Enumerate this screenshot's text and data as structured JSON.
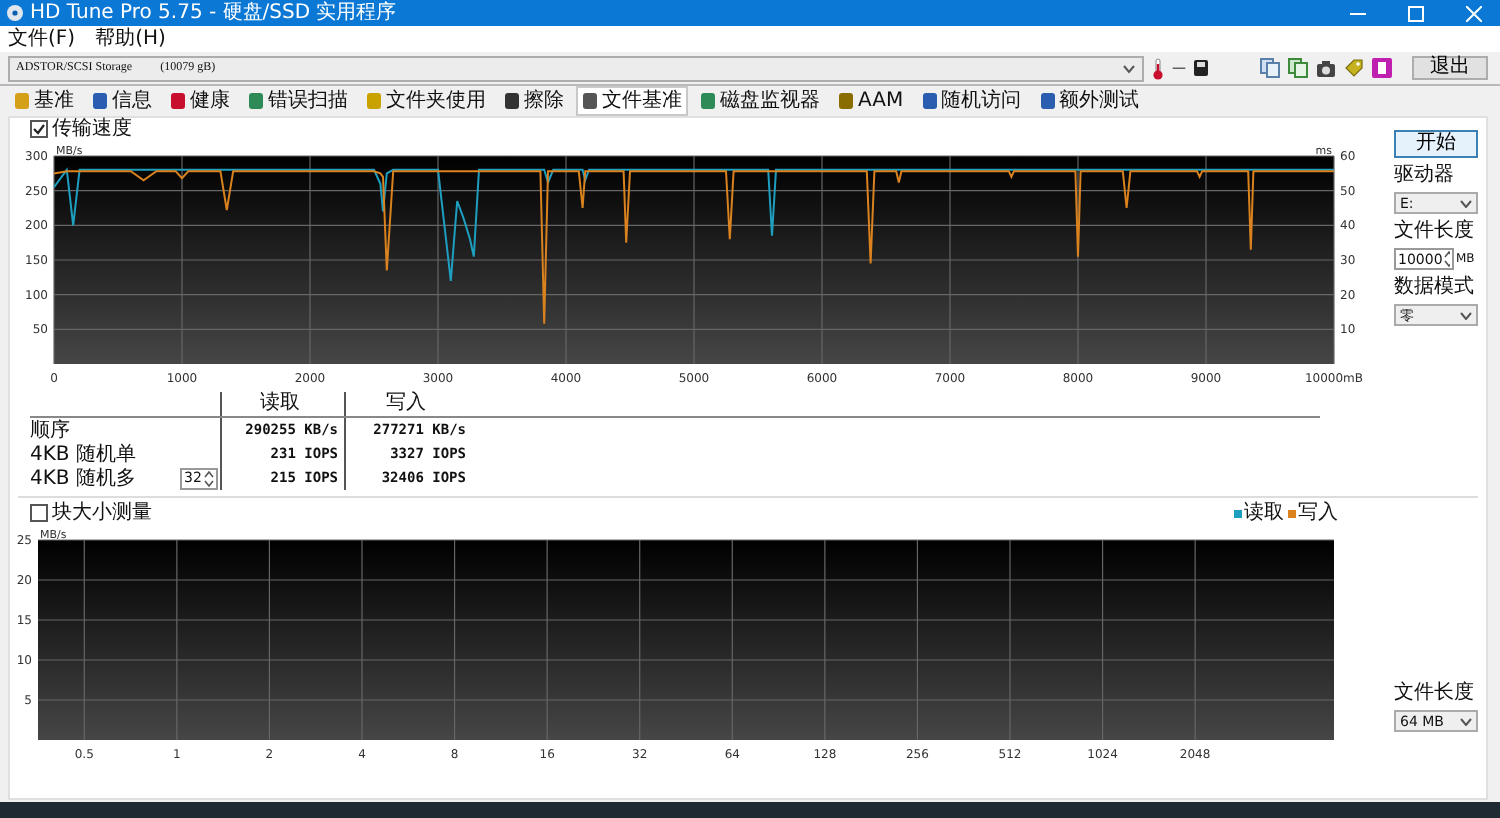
{
  "window": {
    "title": "HD Tune Pro 5.75 - 硬盘/SSD 实用程序"
  },
  "menu": [
    "文件(F)",
    "帮助(H)"
  ],
  "drive_bar": {
    "drive": "ADSTOR/SCSI Storage",
    "capacity": "(10079 gB)",
    "temperature": "—",
    "exit_button": "退出"
  },
  "tabs": [
    {
      "label": "基准",
      "selected": false
    },
    {
      "label": "信息",
      "selected": false
    },
    {
      "label": "健康",
      "selected": false
    },
    {
      "label": "错误扫描",
      "selected": false
    },
    {
      "label": "文件夹使用",
      "selected": false
    },
    {
      "label": "擦除",
      "selected": false
    },
    {
      "label": "文件基准",
      "selected": true
    },
    {
      "label": "磁盘监视器",
      "selected": false
    },
    {
      "label": "AAM",
      "selected": false
    },
    {
      "label": "随机访问",
      "selected": false
    },
    {
      "label": "额外测试",
      "selected": false
    }
  ],
  "transfer": {
    "checkbox": {
      "label": "传输速度",
      "checked": true
    },
    "right_axis": {
      "label": "ms",
      "ticks": [
        "60",
        "50",
        "40",
        "30",
        "20",
        "10"
      ]
    },
    "chart_data": {
      "type": "line",
      "ylabel": "MB/s",
      "xlim": [
        0,
        10000
      ],
      "ylim": [
        0,
        300
      ],
      "grid": true,
      "xticks": [
        0,
        1000,
        2000,
        3000,
        4000,
        5000,
        6000,
        7000,
        8000,
        9000,
        {
          "value": 10000,
          "label": "10000mB"
        }
      ],
      "yticks": [
        50,
        100,
        150,
        200,
        250,
        300
      ],
      "x": [
        0,
        100,
        150,
        200,
        600,
        700,
        800,
        950,
        1000,
        1050,
        1300,
        1350,
        1400,
        2500,
        2550,
        2570,
        2600,
        2650,
        3000,
        3100,
        3150,
        3200,
        3250,
        3280,
        3320,
        3800,
        3830,
        3860,
        3900,
        4100,
        4130,
        4150,
        4180,
        4450,
        4470,
        4500,
        5250,
        5280,
        5310,
        5580,
        5610,
        5640,
        6350,
        6380,
        6410,
        6580,
        6600,
        6620,
        7460,
        7480,
        7500,
        7980,
        8000,
        8020,
        8350,
        8380,
        8410,
        8930,
        8950,
        8970,
        9330,
        9350,
        9370,
        10000
      ],
      "series": [
        {
          "color": "#1e9fc0",
          "values": [
            255,
            280,
            200,
            280,
            280,
            280,
            280,
            280,
            280,
            280,
            280,
            280,
            280,
            280,
            260,
            220,
            275,
            280,
            280,
            120,
            235,
            210,
            180,
            155,
            280,
            280,
            280,
            262,
            280,
            280,
            280,
            265,
            280,
            280,
            280,
            280,
            280,
            280,
            280,
            280,
            185,
            280,
            280,
            280,
            280,
            280,
            280,
            280,
            280,
            280,
            280,
            280,
            280,
            280,
            280,
            280,
            280,
            280,
            280,
            280,
            280,
            280,
            280,
            280
          ]
        },
        {
          "color": "#d9821e",
          "values": [
            275,
            278,
            278,
            278,
            278,
            265,
            278,
            278,
            268,
            278,
            278,
            222,
            278,
            278,
            275,
            270,
            135,
            278,
            278,
            278,
            278,
            278,
            278,
            278,
            278,
            278,
            58,
            278,
            278,
            278,
            225,
            278,
            278,
            278,
            175,
            278,
            278,
            180,
            278,
            278,
            278,
            278,
            278,
            145,
            278,
            278,
            262,
            278,
            278,
            270,
            278,
            278,
            155,
            278,
            278,
            225,
            278,
            278,
            270,
            278,
            278,
            165,
            278,
            278
          ]
        }
      ]
    }
  },
  "results": {
    "columns": [
      "读取",
      "写入"
    ],
    "rows": [
      {
        "label": "顺序",
        "read": "290255 KB/s",
        "write": "277271 KB/s"
      },
      {
        "label": "4KB 随机单",
        "read": "231 IOPS",
        "write": "3327 IOPS"
      },
      {
        "label": "4KB 随机多",
        "queue": "32",
        "read": "215 IOPS",
        "write": "32406 IOPS"
      }
    ]
  },
  "side_panel": {
    "start_button": "开始",
    "drive_label": "驱动器",
    "drive": "E:",
    "file_length_label": "文件长度",
    "file_length": "10000",
    "unit": "MB",
    "data_mode_label": "数据模式",
    "data_mode": "零"
  },
  "block_size": {
    "checkbox": {
      "label": "块大小测量",
      "checked": false
    },
    "chart_data": {
      "type": "bar",
      "ylabel": "MB/s",
      "ylim": [
        0,
        25
      ],
      "yticks": [
        5,
        10,
        15,
        20,
        25
      ],
      "grid": true,
      "categories": [
        "0.5",
        "1",
        "2",
        "4",
        "8",
        "16",
        "32",
        "64",
        "128",
        "256",
        "512",
        "1024",
        "2048"
      ],
      "series": [
        {
          "name": "读取",
          "color": "#1e9fc0",
          "values": [
            null,
            null,
            null,
            null,
            null,
            null,
            null,
            null,
            null,
            null,
            null,
            null,
            null
          ]
        },
        {
          "name": "写入",
          "color": "#d9821e",
          "values": [
            null,
            null,
            null,
            null,
            null,
            null,
            null,
            null,
            null,
            null,
            null,
            null,
            null
          ]
        }
      ]
    },
    "side_panel": {
      "file_length_label": "文件长度",
      "file_length": "64 MB"
    }
  }
}
